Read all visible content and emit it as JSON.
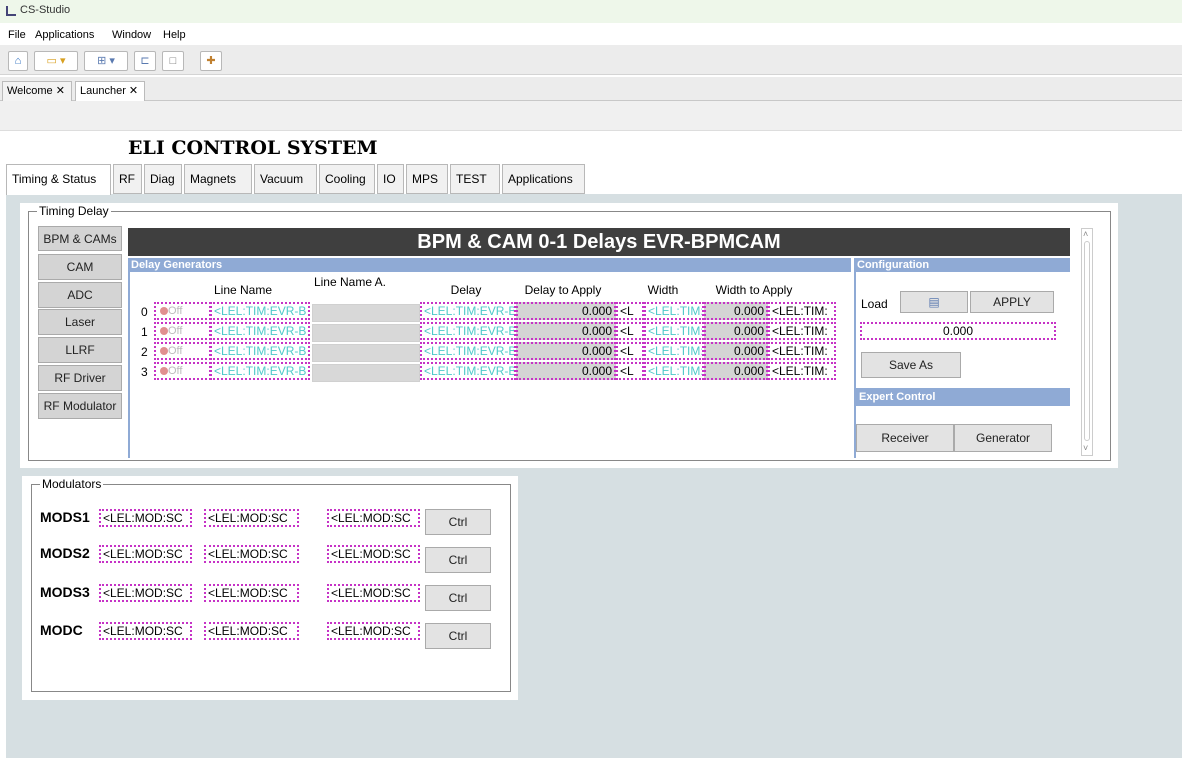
{
  "window": {
    "title": "CS-Studio"
  },
  "menu": [
    "File",
    "Applications",
    "Window",
    "Help"
  ],
  "editor_tabs": [
    {
      "label": "Welcome ✕"
    },
    {
      "label": "Launcher ✕"
    }
  ],
  "main_title": "ELI CONTROL SYSTEM",
  "main_tabs": [
    "Timing & Status",
    "RF",
    "Diag",
    "Magnets",
    "Vacuum",
    "Cooling",
    "IO",
    "MPS",
    "TEST",
    "Applications"
  ],
  "timing_delay": {
    "group_title": "Timing Delay",
    "side_buttons": [
      "BPM & CAMs",
      "CAM",
      "ADC",
      "Laser",
      "LLRF",
      "RF Driver",
      "RF Modulator"
    ],
    "banner": "BPM & CAM 0-1 Delays  EVR-BPMCAM",
    "delay_generators_title": "Delay Generators",
    "columns": {
      "line_name": "Line Name",
      "line_name_a": "Line Name A.",
      "delay": "Delay",
      "delay_to_apply": "Delay to Apply",
      "width": "Width",
      "width_to_apply": "Width to Apply"
    },
    "rows": [
      {
        "index": "0",
        "state": "Off",
        "line_name": "<LEL:TIM:EVR-B",
        "delay": "<LEL:TIM:EVR-B",
        "delay_to_apply": "0.000",
        "delay_pv": "<L",
        "width": "<LEL:TIM:",
        "width_to_apply": "0.000",
        "width_pv": "<LEL:TIM:"
      },
      {
        "index": "1",
        "state": "Off",
        "line_name": "<LEL:TIM:EVR-B",
        "delay": "<LEL:TIM:EVR-B",
        "delay_to_apply": "0.000",
        "delay_pv": "<L",
        "width": "<LEL:TIM:",
        "width_to_apply": "0.000",
        "width_pv": "<LEL:TIM:"
      },
      {
        "index": "2",
        "state": "Off",
        "line_name": "<LEL:TIM:EVR-B",
        "delay": "<LEL:TIM:EVR-B",
        "delay_to_apply": "0.000",
        "delay_pv": "<L",
        "width": "<LEL:TIM:",
        "width_to_apply": "0.000",
        "width_pv": "<LEL:TIM:"
      },
      {
        "index": "3",
        "state": "Off",
        "line_name": "<LEL:TIM:EVR-B",
        "delay": "<LEL:TIM:EVR-B",
        "delay_to_apply": "0.000",
        "delay_pv": "<L",
        "width": "<LEL:TIM:",
        "width_to_apply": "0.000",
        "width_pv": "<LEL:TIM:"
      }
    ],
    "configuration": {
      "title": "Configuration",
      "load_label": "Load",
      "apply_label": "APPLY",
      "value": "0.000",
      "save_as_label": "Save As"
    },
    "expert_control": {
      "title": "Expert Control",
      "receiver_label": "Receiver",
      "generator_label": "Generator"
    }
  },
  "modulators": {
    "group_title": "Modulators",
    "rows": [
      {
        "label": "MODS1",
        "pv1": "<LEL:MOD:SC",
        "pv2": "<LEL:MOD:SC",
        "pv3": "<LEL:MOD:SC",
        "ctrl": "Ctrl"
      },
      {
        "label": "MODS2",
        "pv1": "<LEL:MOD:SC",
        "pv2": "<LEL:MOD:SC",
        "pv3": "<LEL:MOD:SC",
        "ctrl": "Ctrl"
      },
      {
        "label": "MODS3",
        "pv1": "<LEL:MOD:SC",
        "pv2": "<LEL:MOD:SC",
        "pv3": "<LEL:MOD:SC",
        "ctrl": "Ctrl"
      },
      {
        "label": "MODC",
        "pv1": "<LEL:MOD:SC",
        "pv2": "<LEL:MOD:SC",
        "pv3": "<LEL:MOD:SC",
        "ctrl": "Ctrl"
      }
    ]
  },
  "colors": {
    "banner": "#3f3f3f",
    "section_header": "#8faad5",
    "pv_border": "#c632c6",
    "pv_text": "#4ec9c9",
    "background": "#d6dfe2"
  }
}
